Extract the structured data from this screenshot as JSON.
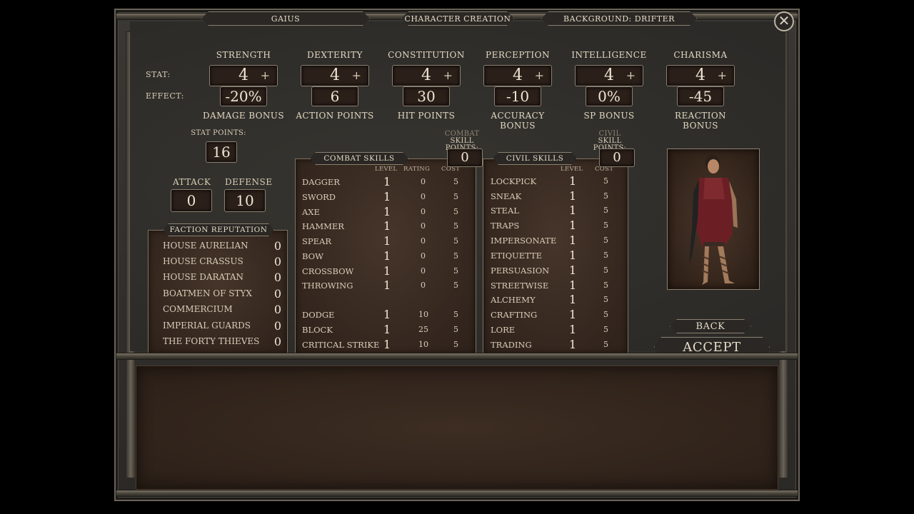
{
  "header": {
    "character_name": "GAIUS",
    "screen_title": "CHARACTER CREATION",
    "background": "BACKGROUND: DRIFTER"
  },
  "labels": {
    "stat": "STAT:",
    "effect": "EFFECT:",
    "stat_points": "STAT POINTS:",
    "attack": "ATTACK",
    "defense": "DEFENSE",
    "combat_skill_points_line1": "COMBAT",
    "combat_skill_points_line2": "SKILL POINTS:",
    "civil_skill_points_line1": "CIVIL",
    "civil_skill_points_line2": "SKILL POINTS:",
    "combat_skills": "COMBAT SKILLS",
    "civil_skills": "CIVIL SKILLS",
    "faction_reputation": "FACTION REPUTATION",
    "level": "LEVEL",
    "rating": "RATING",
    "cost": "COST",
    "plus": "+"
  },
  "stats": [
    {
      "name": "STRENGTH",
      "value": "4",
      "effect": "-20%",
      "effect_label": "DAMAGE BONUS"
    },
    {
      "name": "DEXTERITY",
      "value": "4",
      "effect": "6",
      "effect_label": "ACTION POINTS"
    },
    {
      "name": "CONSTITUTION",
      "value": "4",
      "effect": "30",
      "effect_label": "HIT POINTS"
    },
    {
      "name": "PERCEPTION",
      "value": "4",
      "effect": "-10",
      "effect_label": "ACCURACY BONUS"
    },
    {
      "name": "INTELLIGENCE",
      "value": "4",
      "effect": "0%",
      "effect_label": "SP BONUS"
    },
    {
      "name": "CHARISMA",
      "value": "4",
      "effect": "-45",
      "effect_label": "REACTION BONUS"
    }
  ],
  "values": {
    "stat_points": "16",
    "attack": "0",
    "defense": "10",
    "combat_skill_points": "0",
    "civil_skill_points": "0"
  },
  "factions": [
    {
      "name": "HOUSE AURELIAN",
      "value": "0"
    },
    {
      "name": "HOUSE CRASSUS",
      "value": "0"
    },
    {
      "name": "HOUSE DARATAN",
      "value": "0"
    },
    {
      "name": "BOATMEN OF STYX",
      "value": "0"
    },
    {
      "name": "COMMERCIUM",
      "value": "0"
    },
    {
      "name": "IMPERIAL GUARDS",
      "value": "0"
    },
    {
      "name": "THE FORTY THIEVES",
      "value": "0"
    }
  ],
  "combat_skills": [
    {
      "name": "DAGGER",
      "level": "1",
      "rating": "0",
      "cost": "5"
    },
    {
      "name": "SWORD",
      "level": "1",
      "rating": "0",
      "cost": "5"
    },
    {
      "name": "AXE",
      "level": "1",
      "rating": "0",
      "cost": "5"
    },
    {
      "name": "HAMMER",
      "level": "1",
      "rating": "0",
      "cost": "5"
    },
    {
      "name": "SPEAR",
      "level": "1",
      "rating": "0",
      "cost": "5"
    },
    {
      "name": "BOW",
      "level": "1",
      "rating": "0",
      "cost": "5"
    },
    {
      "name": "CROSSBOW",
      "level": "1",
      "rating": "0",
      "cost": "5"
    },
    {
      "name": "THROWING",
      "level": "1",
      "rating": "0",
      "cost": "5"
    },
    {
      "name": "DODGE",
      "level": "1",
      "rating": "10",
      "cost": "5"
    },
    {
      "name": "BLOCK",
      "level": "1",
      "rating": "25",
      "cost": "5"
    },
    {
      "name": "CRITICAL STRIKE",
      "level": "1",
      "rating": "10",
      "cost": "5"
    }
  ],
  "civil_skills": [
    {
      "name": "LOCKPICK",
      "level": "1",
      "cost": "5"
    },
    {
      "name": "SNEAK",
      "level": "1",
      "cost": "5"
    },
    {
      "name": "STEAL",
      "level": "1",
      "cost": "5"
    },
    {
      "name": "TRAPS",
      "level": "1",
      "cost": "5"
    },
    {
      "name": "IMPERSONATE",
      "level": "1",
      "cost": "5"
    },
    {
      "name": "ETIQUETTE",
      "level": "1",
      "cost": "5"
    },
    {
      "name": "PERSUASION",
      "level": "1",
      "cost": "5"
    },
    {
      "name": "STREETWISE",
      "level": "1",
      "cost": "5"
    },
    {
      "name": "ALCHEMY",
      "level": "1",
      "cost": "5"
    },
    {
      "name": "CRAFTING",
      "level": "1",
      "cost": "5"
    },
    {
      "name": "LORE",
      "level": "1",
      "cost": "5"
    },
    {
      "name": "TRADING",
      "level": "1",
      "cost": "5"
    }
  ],
  "buttons": {
    "back": "BACK",
    "accept": "ACCEPT",
    "close": "✕"
  },
  "icons": {
    "close": "close-icon",
    "plus": "plus-icon"
  }
}
